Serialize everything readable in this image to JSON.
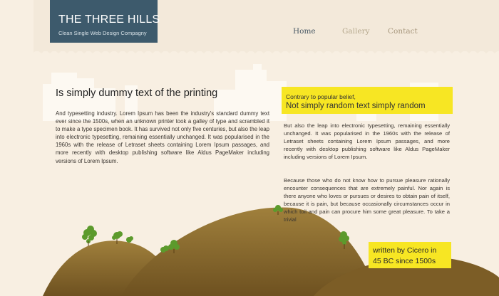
{
  "brand": {
    "title": "THE THREE HILLS",
    "tagline": "Clean Single Web Design Compagny"
  },
  "nav": {
    "items": [
      "Home",
      "Gallery",
      "Contact"
    ]
  },
  "main": {
    "heading": "Is simply dummy text of the printing",
    "body": "And typesetting industry. Lorem Ipsum has been the industry's standard dummy text ever since the 1500s, when an unknown printer took a galley of type and scrambled it to make a type specimen book. It has survived not only five centuries, but also the  leap into electronic typesetting, remaining essentially unchanged. It was popularised in the 1960s with the release of Letraset sheets containing Lorem Ipsum passages, and more recently with desktop publishing software like Aldus PageMaker including versions of Lorem Ipsum."
  },
  "sidebar": {
    "callout_small": "Contrary to popular belief,",
    "callout_big": "Not simply random text simply random",
    "paragraph1": "But also the  leap into electronic typesetting, remaining essentially unchanged. It was popularised in the 1960s with the release of Letraset sheets containing Lorem Ipsum passages, and more recently with desktop publishing software like Aldus PageMaker including versions of Lorem Ipsum.",
    "paragraph2": "Because those who do not know how to pursue pleasure rationally encounter consequences that are extremely painful. Nor again is there anyone who loves or pursues or desires to obtain pain of itself, because it is pain, but because occasionally circumstances occur in which toil and pain can procure him some great pleasure. To take a trivial"
  },
  "signature": {
    "line1": "written by Cicero in",
    "line2": "45 BC since 1500s"
  },
  "colors": {
    "background": "#f8efe2",
    "logo_bg": "#3d5a6c",
    "highlight": "#f7e623",
    "hill": "#8b6a2e",
    "tree": "#5c9a2c"
  }
}
